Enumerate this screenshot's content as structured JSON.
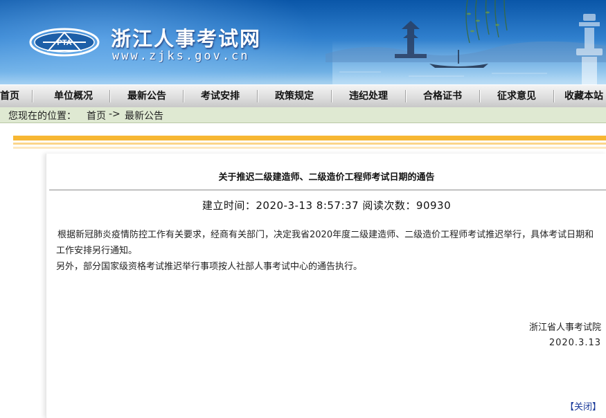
{
  "header": {
    "site_title": "浙江人事考试网",
    "site_url": "www.zjks.gov.cn",
    "logo_text": "PTA",
    "brand_color": "#1462b4"
  },
  "nav": {
    "items": [
      {
        "label": "首页"
      },
      {
        "label": "单位概况"
      },
      {
        "label": "最新公告"
      },
      {
        "label": "考试安排"
      },
      {
        "label": "政策规定"
      },
      {
        "label": "违纪处理"
      },
      {
        "label": "合格证书"
      },
      {
        "label": "征求意见"
      },
      {
        "label": "收藏本站"
      }
    ]
  },
  "breadcrumb": {
    "label": "您现在的位置：",
    "home": "首页",
    "separator": "->",
    "current": "最新公告"
  },
  "article": {
    "title": "关于推迟二级建造师、二级造价工程师考试日期的通告",
    "created_label": "建立时间：",
    "created_value": "2020-3-13 8:57:37",
    "views_label": "阅读次数：",
    "views_value": "90930",
    "paragraphs": [
      "根据新冠肺炎疫情防控工作有关要求，经商有关部门，决定我省2020年度二级建造师、二级造价工程师考试推迟举行，具体考试日期和工作安排另行通知。",
      "另外，部分国家级资格考试推迟举行事项按人社部人事考试中心的通告执行。"
    ],
    "signature_org": "浙江省人事考试院",
    "signature_date": "2020.3.13",
    "close_label": "【关闭】"
  },
  "colors": {
    "stripe_main": "#f7b733",
    "breadcrumb_bg": "#dfe9d2"
  }
}
